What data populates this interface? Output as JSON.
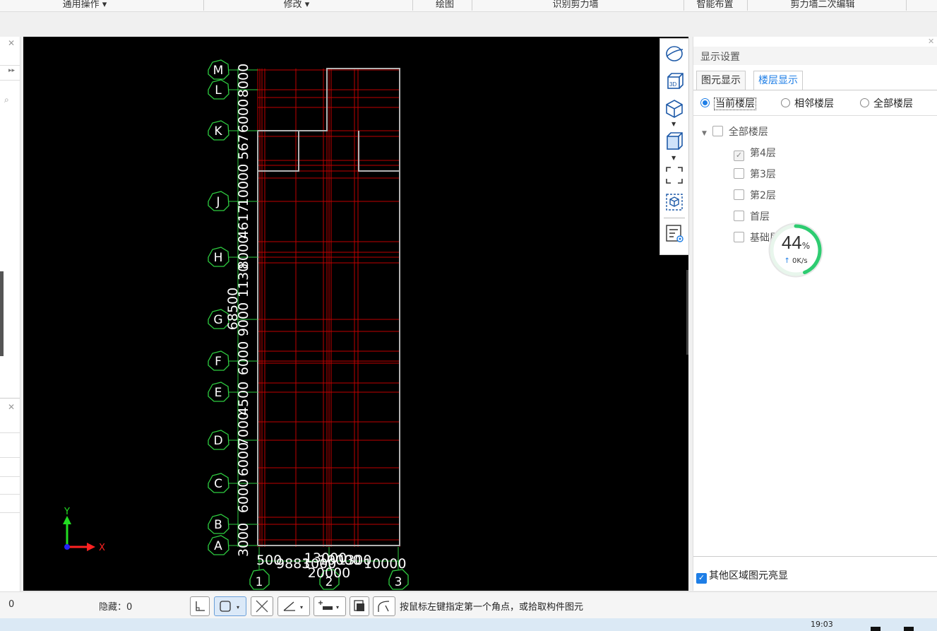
{
  "ribbon": {
    "groups": [
      "通用操作 ▾",
      "修改 ▾",
      "绘图",
      "识别剪力墙",
      "智能布置",
      "剪力墙二次编辑"
    ]
  },
  "drawing": {
    "axes_vertical": [
      "M",
      "L",
      "K",
      "J",
      "H",
      "G",
      "F",
      "E",
      "D",
      "C",
      "B",
      "A"
    ],
    "axes_horizontal": [
      "1",
      "2",
      "3"
    ],
    "dims_vertical": [
      "3000",
      "6000",
      "6000",
      "7000",
      "4500",
      "6000",
      "9000",
      "1130",
      "8000",
      "4617",
      "10000",
      "567",
      "6000",
      "8000"
    ],
    "dim_total_vertical": "68500",
    "dims_horizontal": [
      "500",
      "9883",
      "1000",
      "10000",
      "1300",
      "10000"
    ],
    "dim_total_horizontal": "20000",
    "dim_horizontal_total_label": "13000",
    "axis_x": "X",
    "axis_y": "Y"
  },
  "vtoolbar": {
    "icons": [
      "orbit-icon",
      "cube-3d-icon",
      "view-cube-icon",
      "box-icon",
      "fit-view-icon",
      "select-view-icon",
      "display-settings-icon"
    ],
    "accent": "#1e7ee6"
  },
  "panel": {
    "title": "显示设置",
    "tabs": [
      "图元显示",
      "楼层显示"
    ],
    "active_tab": "楼层显示",
    "radios": [
      "当前楼层",
      "相邻楼层",
      "全部楼层"
    ],
    "radio_selected": "当前楼层",
    "tree_root": "全部楼层",
    "floors": [
      {
        "label": "第4层",
        "checked": true
      },
      {
        "label": "第3层",
        "checked": false
      },
      {
        "label": "第2层",
        "checked": false
      },
      {
        "label": "首层",
        "checked": false
      },
      {
        "label": "基础层",
        "checked": false
      }
    ],
    "bottom_checkbox": "其他区域图元亮显",
    "bottom_checked": true
  },
  "progress": {
    "value": "44",
    "unit": "%",
    "speed": "0K/s",
    "fraction": 0.44
  },
  "status": {
    "left_value": "0",
    "hidden_label": "隐藏：0",
    "hint": "按鼠标左键指定第一个角点，或拾取构件图元"
  },
  "clock": "19:03"
}
